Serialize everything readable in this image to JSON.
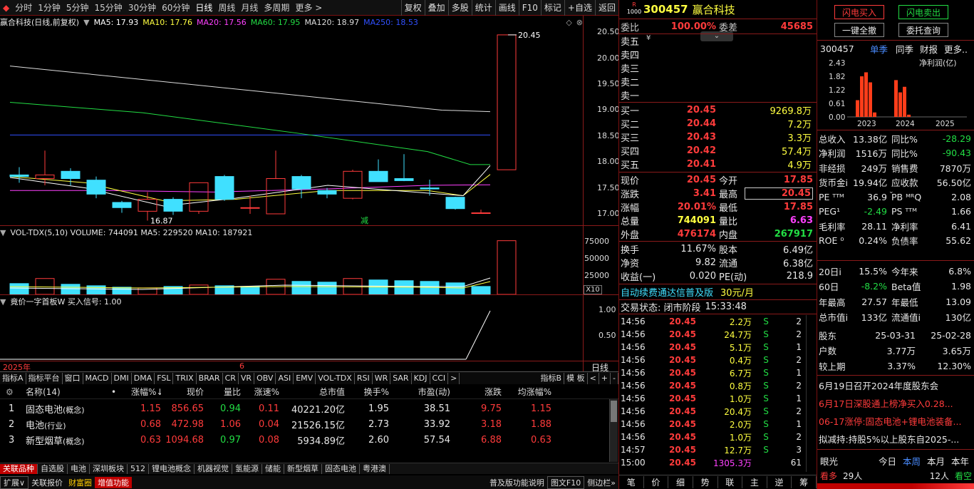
{
  "toolbar": {
    "periods": [
      "分时",
      "1分钟",
      "5分钟",
      "15分钟",
      "30分钟",
      "60分钟",
      "日线",
      "周线",
      "月线",
      "多周期",
      "更多 >"
    ],
    "active": "日线",
    "right": [
      "复权",
      "叠加",
      "多股",
      "统计",
      "画线",
      "F10",
      "标记",
      "+自选",
      "返回"
    ]
  },
  "chart": {
    "title": "赢合科技(日线,前复权)",
    "ma": [
      {
        "label": "MA5: 17.93",
        "color": "#ffffff"
      },
      {
        "label": "MA10: 17.76",
        "color": "#ffff40"
      },
      {
        "label": "MA20: 17.56",
        "color": "#ff40ff"
      },
      {
        "label": "MA60: 17.95",
        "color": "#22dd44"
      },
      {
        "label": "MA120: 18.97",
        "color": "#dddddd"
      },
      {
        "label": "MA250: 18.53",
        "color": "#3050ff"
      }
    ],
    "price_axis": [
      "20.50",
      "20.00",
      "19.50",
      "19.00",
      "18.50",
      "18.00",
      "17.50",
      "17.00"
    ],
    "high_label": "20.45",
    "low_label": "16.87",
    "jian_label": "减",
    "vol_info": "VOL-TDX(5,10) VOLUME: 744091 MA5: 229520 MA10: 187921",
    "vol_axis": [
      "75000",
      "50000",
      "25000"
    ],
    "vol_unit": "X10",
    "signal_info": "竟价一字首板W 买入信号: 1.00",
    "signal_axis": [
      "1.00",
      "0.50"
    ],
    "date_left": "2025年",
    "date_mid": "6",
    "period_label": "日线"
  },
  "chart_data": {
    "type": "candlestick",
    "candles": [
      {
        "o": 17.75,
        "c": 17.72,
        "h": 17.9,
        "l": 17.6
      },
      {
        "o": 17.68,
        "c": 17.75,
        "h": 18.22,
        "l": 17.55
      },
      {
        "o": 17.82,
        "c": 17.68,
        "h": 17.88,
        "l": 17.55
      },
      {
        "o": 17.65,
        "c": 17.38,
        "h": 17.72,
        "l": 17.3
      },
      {
        "o": 17.22,
        "c": 17.12,
        "h": 17.25,
        "l": 17.02
      },
      {
        "o": 17.05,
        "c": 17.28,
        "h": 17.42,
        "l": 16.87
      },
      {
        "o": 17.28,
        "c": 17.05,
        "h": 17.32,
        "l": 16.98
      },
      {
        "o": 17.05,
        "c": 17.6,
        "h": 17.6,
        "l": 17.0
      },
      {
        "o": 17.72,
        "c": 17.28,
        "h": 17.75,
        "l": 17.25
      },
      {
        "o": 17.12,
        "c": 17.12,
        "h": 17.35,
        "l": 17.0
      },
      {
        "o": 17.0,
        "c": 17.68,
        "h": 18.22,
        "l": 17.0
      },
      {
        "o": 17.72,
        "c": 17.48,
        "h": 17.75,
        "l": 17.3
      },
      {
        "o": 17.45,
        "c": 17.38,
        "h": 17.5,
        "l": 17.3
      },
      {
        "o": 17.3,
        "c": 17.82,
        "h": 17.85,
        "l": 17.28
      },
      {
        "o": 17.82,
        "c": 17.62,
        "h": 18.05,
        "l": 17.62
      },
      {
        "o": 17.68,
        "c": 17.64,
        "h": 18.15,
        "l": 17.63
      },
      {
        "o": 17.5,
        "c": 17.48,
        "h": 17.66,
        "l": 17.35
      },
      {
        "o": 17.32,
        "c": 17.1,
        "h": 17.33,
        "l": 17.08
      },
      {
        "o": 17.02,
        "c": 17.02,
        "h": 17.08,
        "l": 17.0
      },
      {
        "o": 17.85,
        "c": 20.45,
        "h": 20.45,
        "l": 17.85
      }
    ],
    "volumes": [
      15000,
      22000,
      14000,
      12000,
      10000,
      9000,
      11000,
      13000,
      12000,
      11000,
      21000,
      18000,
      17000,
      22000,
      20000,
      19000,
      18000,
      16000,
      11000,
      74409
    ]
  },
  "tabs": [
    "指标A",
    "指标平台",
    "窗口",
    "MACD",
    "DMI",
    "DMA",
    "FSL",
    "TRIX",
    "BRAR",
    "CR",
    "VR",
    "OBV",
    "ASI",
    "EMV",
    "VOL-TDX",
    "RSI",
    "WR",
    "SAR",
    "KDJ",
    "CCI",
    ">",
    "指标B",
    "模 板",
    "<",
    "+",
    "-"
  ],
  "table": {
    "headers": [
      "名称(14)",
      "•",
      "涨幅%↓",
      "现价",
      "量比",
      "涨速%",
      "总市值",
      "换手%",
      "市盈(动)",
      "涨跌",
      "均涨幅%"
    ],
    "rows": [
      {
        "idx": "1",
        "name": "固态电池",
        "tag": "(概念)",
        "chg": "1.15",
        "price": "856.65",
        "lb": "0.94",
        "spd": "0.11",
        "cap": "40221.20亿",
        "turn": "1.95",
        "pe": "38.51",
        "diff": "9.75",
        "avg": "1.15"
      },
      {
        "idx": "2",
        "name": "电池",
        "tag": "(行业)",
        "chg": "0.68",
        "price": "472.98",
        "lb": "1.06",
        "spd": "0.04",
        "cap": "21526.15亿",
        "turn": "2.73",
        "pe": "33.92",
        "diff": "3.18",
        "avg": "1.88"
      },
      {
        "idx": "3",
        "name": "新型烟草",
        "tag": "(概念)",
        "chg": "0.63",
        "price": "1094.68",
        "lb": "0.97",
        "spd": "0.08",
        "cap": "5934.89亿",
        "turn": "2.60",
        "pe": "57.54",
        "diff": "6.88",
        "avg": "0.63"
      }
    ]
  },
  "bottom_tabs": [
    "关联品种",
    "自选股",
    "电池",
    "深圳板块",
    "512",
    "锂电池概念",
    "机器视觉",
    "氢能源",
    "储能",
    "新型烟草",
    "固态电池",
    "粤港澳"
  ],
  "status": [
    "扩展∨",
    "关联报价",
    "财富圈",
    "增值功能",
    "普及版功能说明",
    "图文F10",
    "侧边栏»"
  ],
  "quote": {
    "code": "300457",
    "name": "赢合科技",
    "wb_label": "委比",
    "wb": "100.00%",
    "wc_label": "委差",
    "wc": "45685",
    "sell": [
      {
        "l": "卖五",
        "p": "",
        "v": ""
      },
      {
        "l": "卖四",
        "p": "",
        "v": ""
      },
      {
        "l": "卖三",
        "p": "",
        "v": ""
      },
      {
        "l": "卖二",
        "p": "",
        "v": ""
      },
      {
        "l": "卖一",
        "p": "",
        "v": ""
      }
    ],
    "buy": [
      {
        "l": "买一",
        "p": "20.45",
        "v": "9269.8万"
      },
      {
        "l": "买二",
        "p": "20.44",
        "v": "7.2万"
      },
      {
        "l": "买三",
        "p": "20.43",
        "v": "3.3万"
      },
      {
        "l": "买四",
        "p": "20.42",
        "v": "57.4万"
      },
      {
        "l": "买五",
        "p": "20.41",
        "v": "4.9万"
      }
    ],
    "stats": [
      [
        "现价",
        "20.45",
        "今开",
        "17.85"
      ],
      [
        "涨跌",
        "3.41",
        "最高",
        "20.45"
      ],
      [
        "涨幅",
        "20.01%",
        "最低",
        "17.85"
      ],
      [
        "总量",
        "744091",
        "量比",
        "6.63"
      ],
      [
        "外盘",
        "476174",
        "内盘",
        "267917"
      ]
    ],
    "stats2": [
      [
        "换手",
        "11.67%",
        "股本",
        "6.49亿"
      ],
      [
        "净资",
        "9.82",
        "流通",
        "6.38亿"
      ],
      [
        "收益(一)",
        "0.020",
        "PE(动)",
        "218.9"
      ]
    ],
    "promo": "自动续费通达信普及版",
    "promo_price": "30元/月",
    "trade_state": "交易状态: 闭市阶段",
    "trade_time": "15:33:48",
    "ticks": [
      [
        "14:56",
        "20.45",
        "2.2万",
        "S",
        "2"
      ],
      [
        "14:56",
        "20.45",
        "24.7万",
        "S",
        "2"
      ],
      [
        "14:56",
        "20.45",
        "5.1万",
        "S",
        "1"
      ],
      [
        "14:56",
        "20.45",
        "0.4万",
        "S",
        "2"
      ],
      [
        "14:56",
        "20.45",
        "6.7万",
        "S",
        "1"
      ],
      [
        "14:56",
        "20.45",
        "0.8万",
        "S",
        "2"
      ],
      [
        "14:56",
        "20.45",
        "1.0万",
        "S",
        "1"
      ],
      [
        "14:56",
        "20.45",
        "20.4万",
        "S",
        "2"
      ],
      [
        "14:56",
        "20.45",
        "2.0万",
        "S",
        "1"
      ],
      [
        "14:56",
        "20.45",
        "1.0万",
        "S",
        "2"
      ],
      [
        "14:57",
        "20.45",
        "12.7万",
        "S",
        "3"
      ],
      [
        "15:00",
        "20.45",
        "1305.3万",
        "",
        "61"
      ]
    ],
    "bottom_tabs": [
      "笔",
      "价",
      "细",
      "势",
      "联",
      "主",
      "逆",
      "筹"
    ]
  },
  "f10": {
    "buttons": [
      "闪电买入",
      "闪电卖出",
      "一键全撤",
      "委托查询"
    ],
    "code": "300457",
    "nav": [
      "单季",
      "同季",
      "财报",
      "更多.."
    ],
    "y_axis": [
      "2.43",
      "1.82",
      "1.22",
      "0.61",
      "0.00"
    ],
    "chart_label": "净利润(亿)",
    "years": [
      "2023",
      "2024",
      "2025"
    ],
    "bars": [
      0.75,
      1.82,
      2.0,
      1.55,
      0.2,
      1.65,
      1.1,
      1.35,
      0.1
    ],
    "rows": [
      [
        "总收入",
        "13.38亿",
        "同比%",
        "-28.29"
      ],
      [
        "净利润",
        "1516万",
        "同比%",
        "-90.43"
      ],
      [
        "非经损",
        "249万",
        "销售费",
        "7870万"
      ],
      [
        "货币金i",
        "19.94亿",
        "应收款",
        "56.50亿"
      ],
      [
        "PE ᵀᵀᴹ",
        "36.9",
        "PB ᴹᴿQ",
        "2.08"
      ],
      [
        "PEG¹",
        "-2.49",
        "PS ᵀᵀᴹ",
        "1.66"
      ],
      [
        "毛利率",
        "28.11",
        "净利率",
        "6.41"
      ],
      [
        "ROE ⁰",
        "0.24%",
        "负债率",
        "55.62"
      ],
      [
        "20日i",
        "15.5%",
        "今年来",
        "6.8%"
      ],
      [
        "60日",
        "-8.2%",
        "Beta值",
        "1.98"
      ],
      [
        "年最高",
        "27.57",
        "年最低",
        "13.09"
      ],
      [
        "总市值i",
        "133亿",
        "流通值i",
        "130亿"
      ]
    ],
    "holders": [
      [
        "股东",
        "25-03-31",
        "25-02-28"
      ],
      [
        "户数",
        "3.77万",
        "3.65万"
      ],
      [
        "较上期",
        "3.37%",
        "12.30%"
      ]
    ],
    "news": [
      "6月19日召开2024年度股东会",
      "6月17日深股通上榜净买入0.28...",
      "06-17涨停:固态电池+锂电池装备...",
      "拟减持:持股5%以上股东自2025-..."
    ],
    "eye_label": "眼光",
    "eye_tabs": [
      "今日",
      "本周",
      "本月",
      "本年"
    ],
    "more_label": "看多",
    "more_count": "29人",
    "more_right": "12人",
    "more_right_label": "看空"
  }
}
